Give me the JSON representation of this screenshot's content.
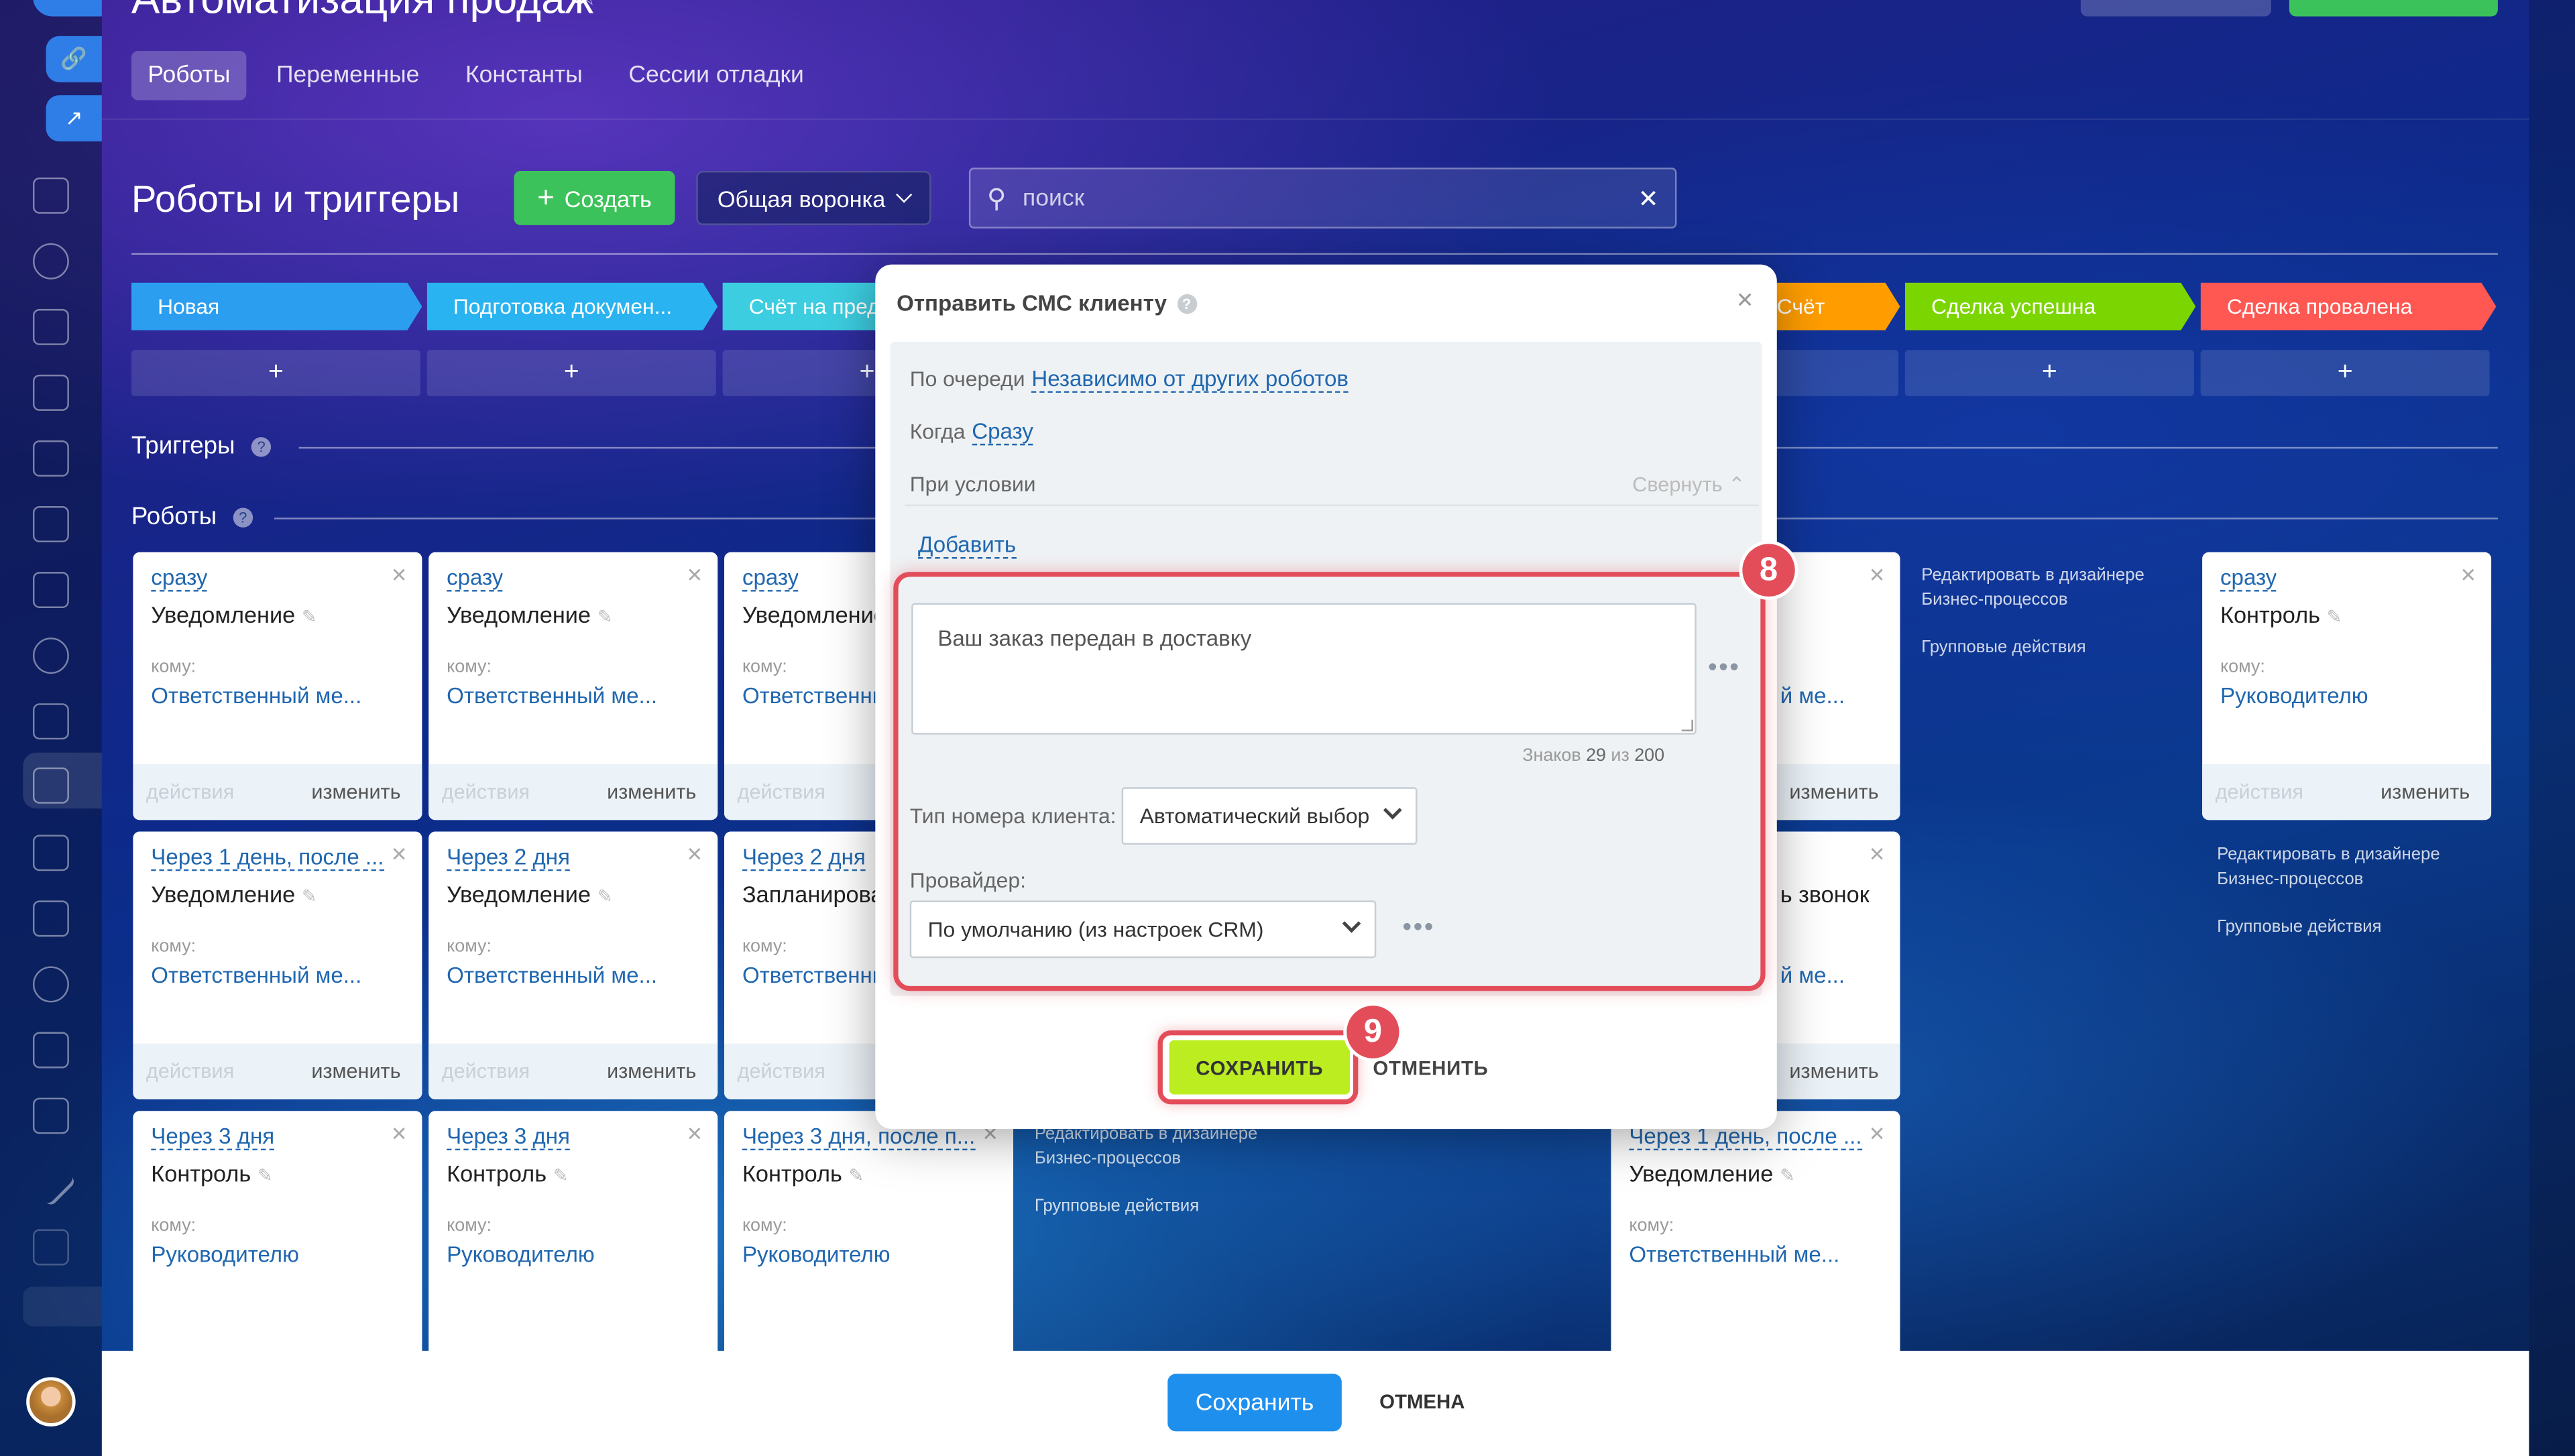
{
  "header": {
    "title": "Автоматизация продаж",
    "tabs": [
      {
        "label": "Роботы",
        "active": true
      },
      {
        "label": "Переменные"
      },
      {
        "label": "Константы"
      },
      {
        "label": "Сессии отладки"
      }
    ]
  },
  "toolbar": {
    "title": "Роботы и триггеры",
    "create_label": "Создать",
    "funnel_label": "Общая воронка",
    "search_placeholder": "поиск"
  },
  "stages": [
    {
      "label": "Новая",
      "color": "#2c9ef0"
    },
    {
      "label": "Подготовка докумен...",
      "color": "#29b3f0"
    },
    {
      "label": "Счёт на предоплату",
      "color": "#3ccde0"
    },
    {
      "label": "Счёт",
      "color": "#ff9d00"
    },
    {
      "label": "Сделка успешна",
      "color": "#7bd500"
    },
    {
      "label": "Сделка провалена",
      "color": "#ff5752"
    }
  ],
  "plus_label": "+",
  "triggers_label": "Триггеры",
  "robots_label": "Роботы",
  "card_labels": {
    "to": "кому:",
    "actions": "действия",
    "change": "изменить"
  },
  "cards": [
    {
      "when": "сразу",
      "name": "Уведомление",
      "to": "Ответственный ме..."
    },
    {
      "when": "сразу",
      "name": "Уведомление",
      "to": "Ответственный ме..."
    },
    {
      "when": "сразу",
      "name": "Уведомление",
      "to": "Ответственный ме..."
    },
    {
      "when": "",
      "name": "",
      "to": "Ответственный ме..."
    },
    {
      "when": "сразу",
      "name": "Контроль",
      "to": "Руководителю"
    },
    {
      "when": "Через 1 день, после ...",
      "name": "Уведомление",
      "to": "Ответственный ме..."
    },
    {
      "when": "Через 2 дня",
      "name": "Уведомление",
      "to": "Ответственный ме..."
    },
    {
      "when": "Через 2 дня",
      "name": "Запланировать",
      "to": "Ответственный ме..."
    },
    {
      "when": "",
      "name": "Звонок",
      "to": "Ответственный ме..."
    },
    {
      "when": "Через 3 дня",
      "name": "Контроль",
      "to": "Руководителю"
    },
    {
      "when": "Через 3 дня",
      "name": "Контроль",
      "to": "Руководителю"
    },
    {
      "when": "Через 3 дня, после п...",
      "name": "Контроль",
      "to": "Руководителю"
    },
    {
      "when": "Через 1 день, после ...",
      "name": "Уведомление",
      "to": "Ответственный ме..."
    }
  ],
  "side_links": {
    "edit": "Редактировать в дизайнере Бизнес-процессов",
    "group": "Групповые действия"
  },
  "modal": {
    "title": "Отправить СМС клиенту",
    "order_label": "По очереди",
    "order_value": "Независимо от других роботов",
    "when_label": "Когда",
    "when_value": "Сразу",
    "condition_label": "При условии",
    "collapse_label": "Свернуть",
    "add_label": "Добавить",
    "message": "Ваш заказ передан в доставку",
    "chars_label": "Знаков",
    "chars_count": "29",
    "chars_of": "из",
    "chars_max": "200",
    "number_type_label": "Тип номера клиента:",
    "number_type_value": "Автоматический выбор",
    "provider_label": "Провайдер:",
    "provider_value": "По умолчанию (из настроек CRM)",
    "save_label": "СОХРАНИТЬ",
    "cancel_label": "ОТМЕНИТЬ"
  },
  "annotations": {
    "badge_8": "8",
    "badge_9": "9",
    "color": "#e34d5a"
  },
  "footer": {
    "save_label": "Сохранить",
    "cancel_label": "ОТМЕНА"
  }
}
